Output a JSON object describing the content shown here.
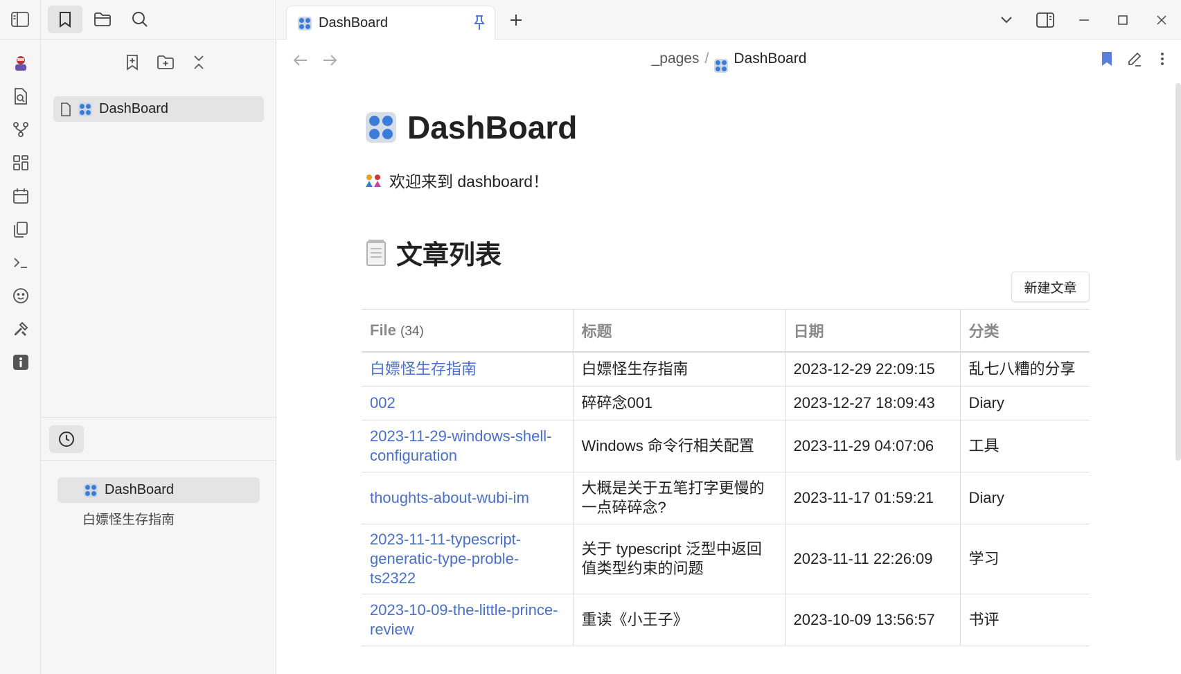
{
  "tab": {
    "title": "DashBoard"
  },
  "breadcrumb": {
    "folder": "_pages",
    "separator": "/",
    "current": "DashBoard"
  },
  "sidebar": {
    "tree_item": "DashBoard",
    "recent": [
      "DashBoard",
      "白嫖怪生存指南"
    ]
  },
  "page": {
    "title": "DashBoard",
    "welcome": "欢迎来到 dashboard！",
    "section_title": "文章列表",
    "new_button": "新建文章"
  },
  "table": {
    "headers": [
      "File",
      "标题",
      "日期",
      "分类"
    ],
    "file_count": "(34)",
    "rows": [
      {
        "file": "白嫖怪生存指南",
        "title": "白嫖怪生存指南",
        "date": "2023-12-29 22:09:15",
        "category": "乱七八糟的分享"
      },
      {
        "file": "002",
        "title": "碎碎念001",
        "date": "2023-12-27 18:09:43",
        "category": "Diary"
      },
      {
        "file": "2023-11-29-windows-shell-configuration",
        "title": "Windows 命令行相关配置",
        "date": "2023-11-29 04:07:06",
        "category": "工具"
      },
      {
        "file": "thoughts-about-wubi-im",
        "title": "大概是关于五笔打字更慢的一点碎碎念?",
        "date": "2023-11-17 01:59:21",
        "category": "Diary"
      },
      {
        "file": "2023-11-11-typescript-generatic-type-proble-ts2322",
        "title": "关于 typescript 泛型中返回值类型约束的问题",
        "date": "2023-11-11 22:26:09",
        "category": "学习"
      },
      {
        "file": "2023-10-09-the-little-prince-review",
        "title": "重读《小王子》",
        "date": "2023-10-09 13:56:57",
        "category": "书评"
      }
    ]
  },
  "colors": {
    "link": "#4a6fc8",
    "accent": "#3d6bd6",
    "bookmark": "#5b7fdb"
  }
}
